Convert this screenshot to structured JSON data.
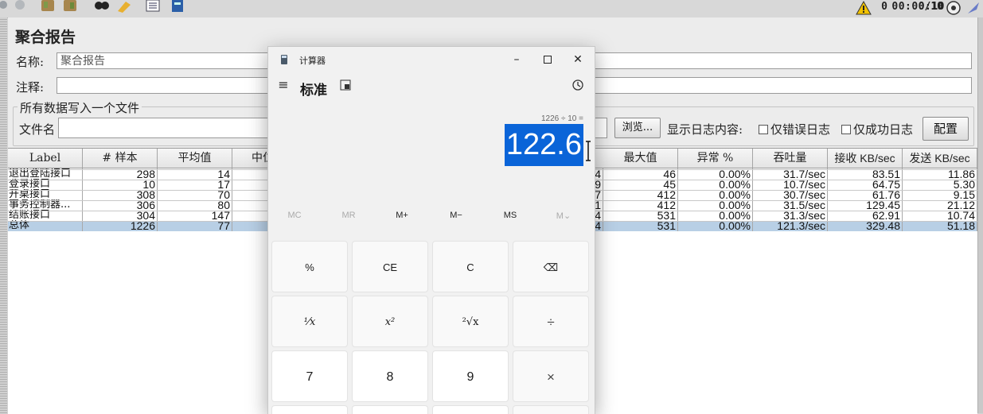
{
  "toolbar": {
    "timer": "00:00:10",
    "warnings": "0",
    "threads": "0/10"
  },
  "report": {
    "title": "聚合报告",
    "name_label": "名称:",
    "name_value": "聚合报告",
    "comment_label": "注释:",
    "comment_value": "",
    "file_group_title": "所有数据写入一个文件",
    "filename_label": "文件名",
    "filename_value": "",
    "browse_button": "浏览...",
    "log_content_label": "显示日志内容:",
    "errors_only_label": "仅错误日志",
    "success_only_label": "仅成功日志",
    "configure_button": "配置"
  },
  "table": {
    "columns": [
      "Label",
      "# 样本",
      "平均值",
      "中位数",
      "最大值",
      "异常 %",
      "吞吐量",
      "接收 KB/sec",
      "发送 KB/sec"
    ],
    "rows": [
      {
        "label": "退出登陆接口",
        "samples": "298",
        "avg": "14",
        "hidden": "4",
        "max": "46",
        "error": "0.00%",
        "throughput": "31.7/sec",
        "recv": "83.51",
        "sent": "11.86"
      },
      {
        "label": "登录接口",
        "samples": "10",
        "avg": "17",
        "hidden": "9",
        "max": "45",
        "error": "0.00%",
        "throughput": "10.7/sec",
        "recv": "64.75",
        "sent": "5.30"
      },
      {
        "label": "开桌接口",
        "samples": "308",
        "avg": "70",
        "hidden": "27",
        "max": "412",
        "error": "0.00%",
        "throughput": "30.7/sec",
        "recv": "61.76",
        "sent": "9.15"
      },
      {
        "label": "事务控制器...",
        "samples": "306",
        "avg": "80",
        "hidden": "31",
        "max": "412",
        "error": "0.00%",
        "throughput": "31.5/sec",
        "recv": "129.45",
        "sent": "21.12"
      },
      {
        "label": "结账接口",
        "samples": "304",
        "avg": "147",
        "hidden": "44",
        "max": "531",
        "error": "0.00%",
        "throughput": "31.3/sec",
        "recv": "62.91",
        "sent": "10.74"
      },
      {
        "label": "总体",
        "samples": "1226",
        "avg": "77",
        "hidden": "4",
        "max": "531",
        "error": "0.00%",
        "throughput": "121.3/sec",
        "recv": "329.48",
        "sent": "51.18"
      }
    ]
  },
  "calculator": {
    "window_title": "计算器",
    "mode": "标准",
    "expression": "1226 ÷ 10 =",
    "result": "122.6",
    "memory": [
      "MC",
      "MR",
      "M+",
      "M−",
      "MS",
      "M⌄"
    ],
    "keys_row1": [
      "%",
      "CE",
      "C",
      "⌫"
    ],
    "keys_row2": [
      "¹⁄x",
      "x²",
      "²√x",
      "÷"
    ],
    "keys_row3": [
      "7",
      "8",
      "9",
      "×"
    ]
  }
}
